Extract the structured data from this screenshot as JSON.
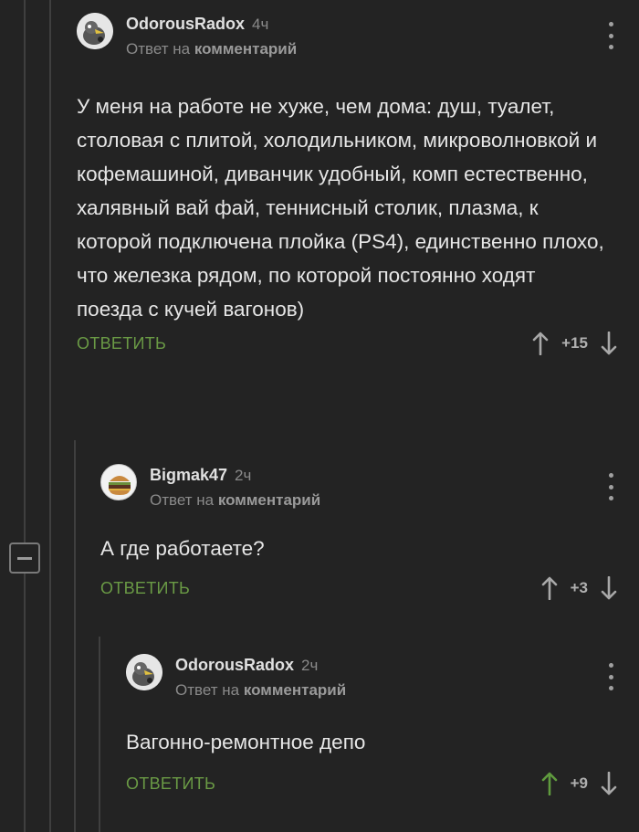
{
  "comments": [
    {
      "author": "OdorousRadox",
      "time": "4ч",
      "reply_prefix": "Ответ на",
      "reply_target": "комментарий",
      "text": "У меня на работе не хуже, чем дома: душ, туалет, столовая с плитой, холодильником, микроволновкой и кофемашиной, диванчик удобный, комп естественно, халявный вай фай, теннисный столик, плазма, к которой подключена плойка (PS4), единственно плохо, что железка рядом, по которой постоянно ходят поезда с кучей вагонов)",
      "reply_label": "ОТВЕТИТЬ",
      "score": "+15",
      "avatar": "penguin-avatar"
    },
    {
      "author": "Bigmak47",
      "time": "2ч",
      "reply_prefix": "Ответ на",
      "reply_target": "комментарий",
      "text": "А где работаете?",
      "reply_label": "ОТВЕТИТЬ",
      "score": "+3",
      "avatar": "burger-avatar"
    },
    {
      "author": "OdorousRadox",
      "time": "2ч",
      "reply_prefix": "Ответ на",
      "reply_target": "комментарий",
      "text": "Вагонно-ремонтное депо",
      "reply_label": "ОТВЕТИТЬ",
      "score": "+9",
      "avatar": "penguin-avatar",
      "upvoted": true
    }
  ],
  "colors": {
    "background": "#232323",
    "reply_green": "#6a9a45",
    "upvote_active": "#5f9a3e",
    "muted": "#8a8a8a"
  }
}
